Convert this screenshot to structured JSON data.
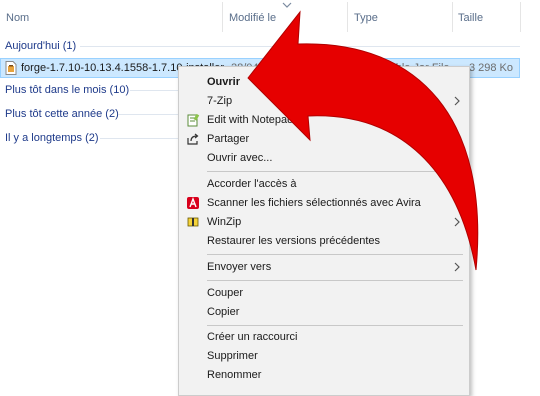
{
  "columns": {
    "name": "Nom",
    "modified": "Modifié le",
    "type": "Type",
    "size": "Taille"
  },
  "groups": [
    {
      "label": "Aujourd'hui (1)"
    },
    {
      "label": "Plus tôt dans le mois (10)"
    },
    {
      "label": "Plus tôt cette année (2)"
    },
    {
      "label": "Il y a longtemps (2)"
    }
  ],
  "file": {
    "name": "forge-1.7.10-10.13.4.1558-1.7.10-installer",
    "date": "28/04",
    "type": "Executable Jar File",
    "size": "3 298 Ko"
  },
  "context_menu": {
    "items": [
      {
        "label": "Ouvrir",
        "icon": "none",
        "bold": true,
        "submenu": false
      },
      {
        "label": "7-Zip",
        "icon": "none",
        "bold": false,
        "submenu": true
      },
      {
        "label": "Edit with Notepad++",
        "icon": "notepad-icon",
        "bold": false,
        "submenu": false
      },
      {
        "label": "Partager",
        "icon": "share-icon",
        "bold": false,
        "submenu": false
      },
      {
        "label": "Ouvrir avec...",
        "icon": "none",
        "bold": false,
        "submenu": false
      },
      {
        "label": "Accorder l'accès à",
        "icon": "none",
        "bold": false,
        "submenu": true
      },
      {
        "label": "Scanner les fichiers sélectionnés avec Avira",
        "icon": "avira-icon",
        "bold": false,
        "submenu": false
      },
      {
        "label": "WinZip",
        "icon": "winzip-icon",
        "bold": false,
        "submenu": true
      },
      {
        "label": "Restaurer les versions précédentes",
        "icon": "none",
        "bold": false,
        "submenu": false
      },
      {
        "label": "Envoyer vers",
        "icon": "none",
        "bold": false,
        "submenu": true
      },
      {
        "label": "Couper",
        "icon": "none",
        "bold": false,
        "submenu": false
      },
      {
        "label": "Copier",
        "icon": "none",
        "bold": false,
        "submenu": false
      },
      {
        "label": "Créer un raccourci",
        "icon": "none",
        "bold": false,
        "submenu": false
      },
      {
        "label": "Supprimer",
        "icon": "none",
        "bold": false,
        "submenu": false
      },
      {
        "label": "Renommer",
        "icon": "none",
        "bold": false,
        "submenu": false
      }
    ]
  },
  "colors": {
    "selection": "#cce8ff",
    "group_text": "#1e3a8a",
    "arrow": "#e60000",
    "menu_bg": "#f2f2f2"
  }
}
